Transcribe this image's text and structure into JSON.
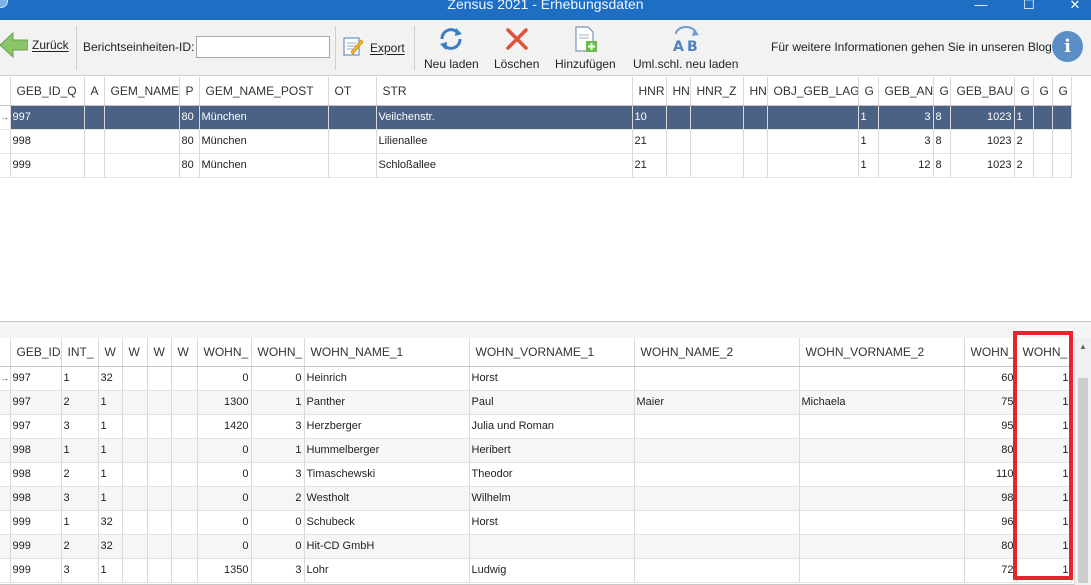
{
  "window": {
    "title": "Zensus 2021 - Erhebungsdaten",
    "min_glyph": "—",
    "max_glyph": "☐",
    "close_glyph": "✕"
  },
  "toolbar": {
    "back_label": "Zurück",
    "bid_label": "Berichtseinheiten-ID:",
    "bid_value": "",
    "export_label": "Export",
    "reload_label": "Neu laden",
    "delete_label": "Löschen",
    "add_label": "Hinzufügen",
    "umlaut_label": "Uml.schl. neu laden",
    "info_text": "Für weitere Informationen gehen Sie in unseren Blog",
    "info_glyph": "i"
  },
  "colors": {
    "titlebar": "#1e6ec4",
    "selection": "#4b6285",
    "highlight": "#e3262e"
  },
  "grid1": {
    "columns": [
      "GEB_ID_Q",
      "A",
      "GEM_NAME",
      "P",
      "GEM_NAME_POST",
      "OT",
      "STR",
      "HNR",
      "HN",
      "HNR_Z",
      "HN",
      "OBJ_GEB_LAGE",
      "G",
      "GEB_ANZ",
      "G",
      "GEB_BAU",
      "G",
      "G",
      "G"
    ],
    "rows": [
      [
        "997",
        "",
        "",
        "80",
        "München",
        "",
        "Veilchenstr.",
        "10",
        "",
        "",
        "",
        "",
        "1",
        "3",
        "8",
        "1023",
        "1",
        "",
        ""
      ],
      [
        "998",
        "",
        "",
        "80",
        "München",
        "",
        "Lilienallee",
        "21",
        "",
        "",
        "",
        "",
        "1",
        "3",
        "8",
        "1023",
        "2",
        "",
        ""
      ],
      [
        "999",
        "",
        "",
        "80",
        "München",
        "",
        "Schloßallee",
        "21",
        "",
        "",
        "",
        "",
        "1",
        "12",
        "8",
        "1023",
        "2",
        "",
        ""
      ]
    ],
    "row_marker": "→"
  },
  "grid2": {
    "columns": [
      "GEB_ID_",
      "INT_",
      "W",
      "W",
      "W",
      "W",
      "WOHN_",
      "WOHN_",
      "WOHN_NAME_1",
      "WOHN_VORNAME_1",
      "WOHN_NAME_2",
      "WOHN_VORNAME_2",
      "WOHN_",
      "WOHN_"
    ],
    "rows": [
      [
        "997",
        "1",
        "32",
        "",
        "",
        "",
        "0",
        "0",
        "Heinrich",
        "Horst",
        "",
        "",
        "60",
        "1"
      ],
      [
        "997",
        "2",
        "1",
        "",
        "",
        "",
        "1300",
        "1",
        "Panther",
        "Paul",
        "Maier",
        "Michaela",
        "75",
        "1"
      ],
      [
        "997",
        "3",
        "1",
        "",
        "",
        "",
        "1420",
        "3",
        "Herzberger",
        "Julia und  Roman",
        "",
        "",
        "95",
        "1"
      ],
      [
        "998",
        "1",
        "1",
        "",
        "",
        "",
        "0",
        "1",
        "Hummelberger",
        "Heribert",
        "",
        "",
        "80",
        "1"
      ],
      [
        "998",
        "2",
        "1",
        "",
        "",
        "",
        "0",
        "3",
        "Timaschewski",
        "Theodor",
        "",
        "",
        "110",
        "1"
      ],
      [
        "998",
        "3",
        "1",
        "",
        "",
        "",
        "0",
        "2",
        "Westholt",
        "Wilhelm",
        "",
        "",
        "98",
        "1"
      ],
      [
        "999",
        "1",
        "32",
        "",
        "",
        "",
        "0",
        "0",
        "Schubeck",
        "Horst",
        "",
        "",
        "96",
        "1"
      ],
      [
        "999",
        "2",
        "32",
        "",
        "",
        "",
        "0",
        "0",
        "Hit-CD GmbH",
        "",
        "",
        "",
        "80",
        "1"
      ],
      [
        "999",
        "3",
        "1",
        "",
        "",
        "",
        "1350",
        "3",
        "Lohr",
        "Ludwig",
        "",
        "",
        "72",
        "1"
      ]
    ],
    "row_marker": "→"
  }
}
